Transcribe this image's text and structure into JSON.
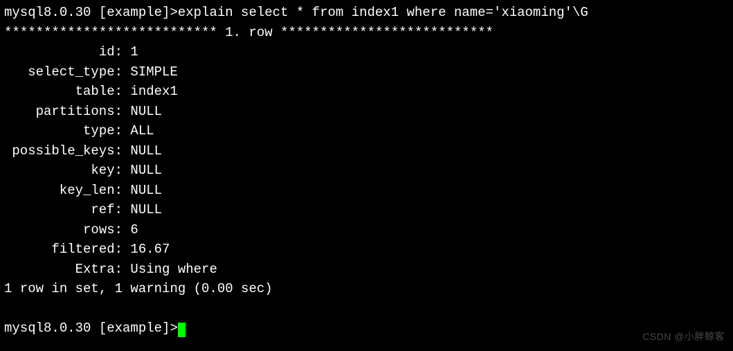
{
  "prompt1": "mysql8.0.30 [example]>",
  "command": "explain select * from index1 where name='xiaoming'\\G",
  "row_header": "*************************** 1. row ***************************",
  "fields": [
    {
      "label": "id",
      "value": "1"
    },
    {
      "label": "select_type",
      "value": "SIMPLE"
    },
    {
      "label": "table",
      "value": "index1"
    },
    {
      "label": "partitions",
      "value": "NULL"
    },
    {
      "label": "type",
      "value": "ALL"
    },
    {
      "label": "possible_keys",
      "value": "NULL"
    },
    {
      "label": "key",
      "value": "NULL"
    },
    {
      "label": "key_len",
      "value": "NULL"
    },
    {
      "label": "ref",
      "value": "NULL"
    },
    {
      "label": "rows",
      "value": "6"
    },
    {
      "label": "filtered",
      "value": "16.67"
    },
    {
      "label": "Extra",
      "value": "Using where"
    }
  ],
  "result_summary": "1 row in set, 1 warning (0.00 sec)",
  "prompt2": "mysql8.0.30 [example]>",
  "watermark": "CSDN @小胖鲸客"
}
